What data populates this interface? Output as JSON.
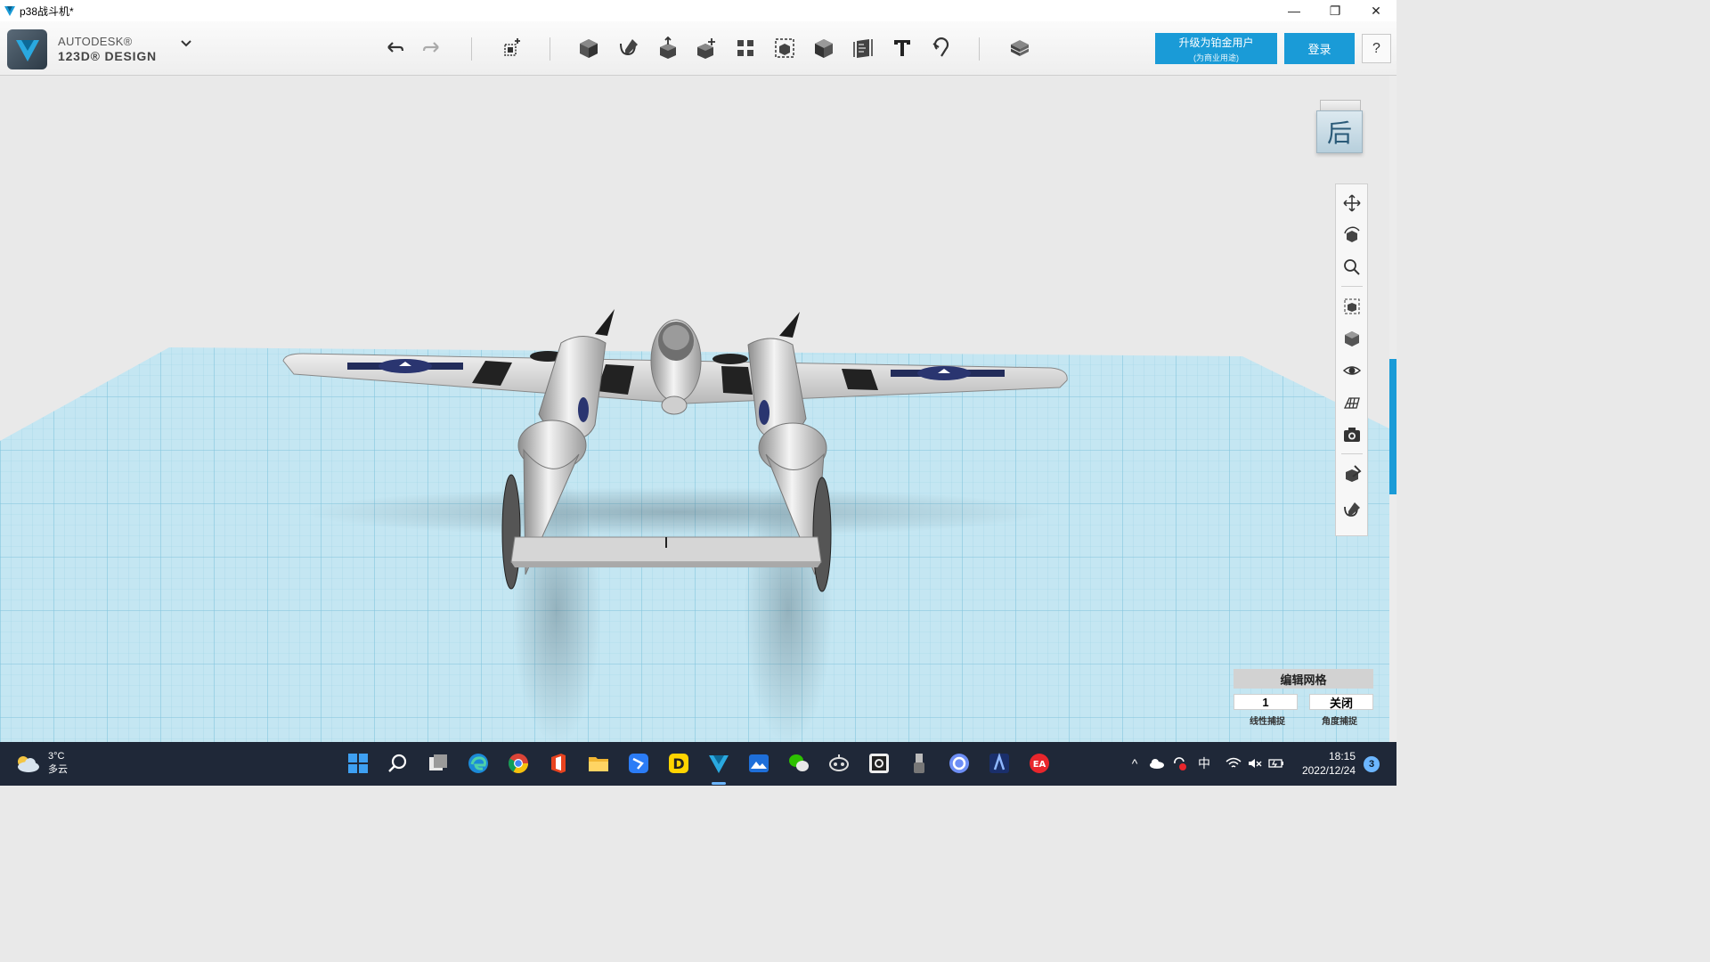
{
  "window": {
    "title": "p38战斗机*",
    "controls": {
      "minimize": "—",
      "restore": "❐",
      "close": "✕"
    }
  },
  "brand": {
    "top": "AUTODESK®",
    "bottom": "123D® DESIGN"
  },
  "toolbar": {
    "icons": [
      "undo-icon",
      "redo-icon",
      "transform-icon",
      "primitives-icon",
      "sketch-icon",
      "construct-icon",
      "modify-icon",
      "pattern-icon",
      "grouping-icon",
      "combine-icon",
      "measure-icon",
      "text-icon",
      "snap-icon",
      "materials-icon"
    ],
    "upgrade_line1": "升级为铂金用户",
    "upgrade_line2": "(为商业用途)",
    "login_label": "登录",
    "help_label": "?"
  },
  "viewcube": {
    "face_label": "后"
  },
  "navbar": {
    "tools": [
      "pan-icon",
      "orbit-icon",
      "zoom-icon",
      "fit-icon",
      "view-icon",
      "visibility-icon",
      "grid-view-icon",
      "screenshot-icon",
      "material-icon",
      "outline-icon"
    ]
  },
  "grid_panel": {
    "title": "编辑网格",
    "linear_value": "1",
    "angle_value": "关闭",
    "linear_label": "线性捕捉",
    "angle_label": "角度捕捉"
  },
  "taskbar": {
    "weather_temp": "3°C",
    "weather_desc": "多云",
    "apps": [
      "windows-start-icon",
      "search-icon",
      "task-view-icon",
      "edge-icon",
      "chrome-icon",
      "office-icon",
      "file-explorer-icon",
      "feishu-icon",
      "note-icon",
      "123d-design-icon",
      "photos-icon",
      "wechat-icon",
      "bot-icon",
      "obs-icon",
      "usb-icon",
      "browser-icon",
      "game-icon",
      "ea-icon"
    ],
    "tray": {
      "chevron": "^",
      "ime": "中"
    },
    "time": "18:15",
    "date": "2022/12/24",
    "notification_count": "3"
  },
  "colors": {
    "accent": "#1a9bd7",
    "taskbar_bg": "#1f2838",
    "grid_blue": "#bfe3ef"
  }
}
